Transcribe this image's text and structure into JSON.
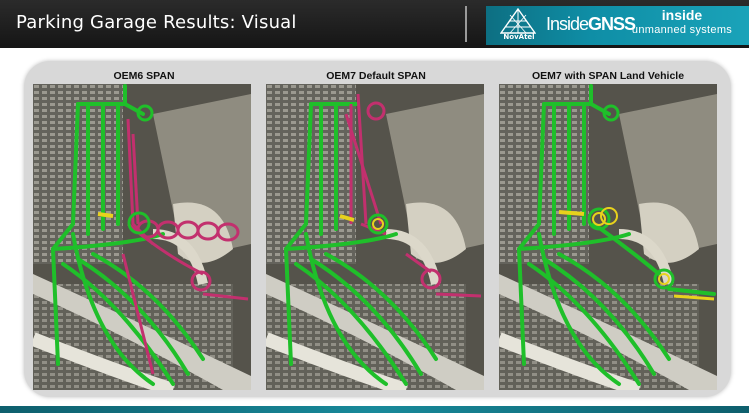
{
  "slide": {
    "title": "Parking Garage Results: Visual"
  },
  "logos": {
    "novatel": "NovAtel",
    "insidegnss_inside": "Inside",
    "insidegnss_gnss": "GNSS",
    "unmanned_line1": "inside",
    "unmanned_line2": "unmanned systems"
  },
  "panels": [
    {
      "label": "OEM6 SPAN",
      "trace": "magenta-heavy"
    },
    {
      "label": "OEM7 Default SPAN",
      "trace": "magenta-partial"
    },
    {
      "label": "OEM7 with SPAN Land Vehicle",
      "trace": "green-yellow"
    }
  ],
  "colors": {
    "header_bg": "#1e1e1e",
    "accent_teal": "#1296ab",
    "track_green": "#1fbf2a",
    "track_magenta": "#c2306e",
    "track_yellow": "#e8d21c"
  }
}
